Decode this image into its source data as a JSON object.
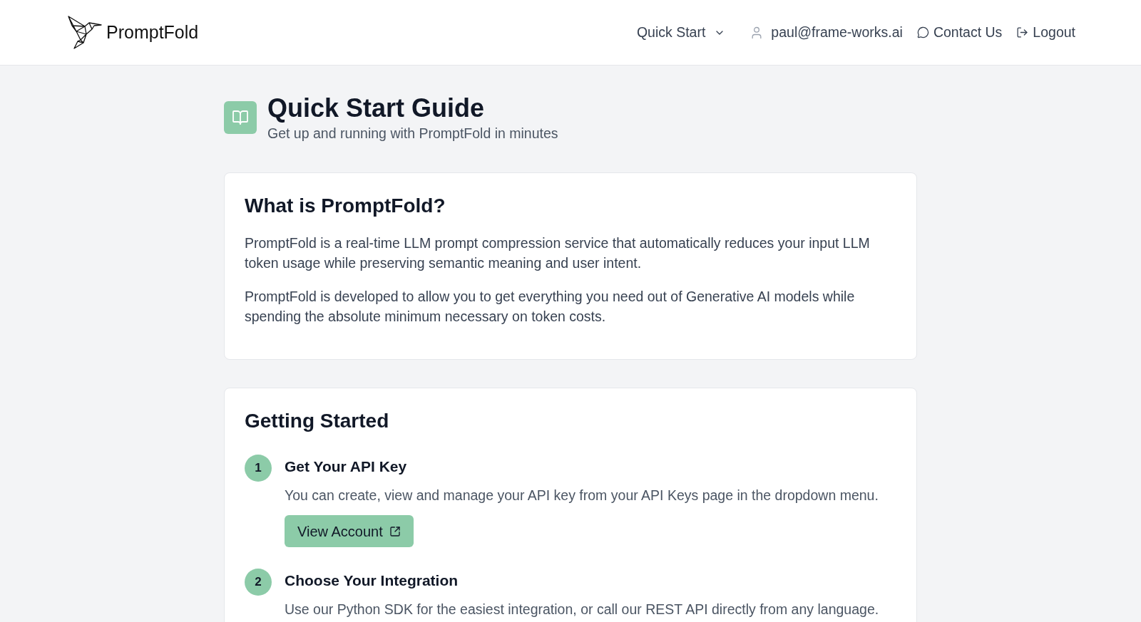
{
  "header": {
    "brand": "PromptFold",
    "nav": [
      {
        "kind": "dropdown",
        "label": "Quick Start"
      },
      {
        "kind": "user",
        "label": "paul@frame-works.ai"
      },
      {
        "kind": "contact",
        "label": "Contact Us"
      },
      {
        "kind": "logout",
        "label": "Logout"
      }
    ]
  },
  "page": {
    "title": "Quick Start Guide",
    "subtitle": "Get up and running with PromptFold in minutes"
  },
  "sections": [
    {
      "heading": "What is PromptFold?",
      "paragraphs": [
        "PromptFold is a real-time LLM prompt compression service that automatically reduces your input LLM token usage while preserving semantic meaning and user intent.",
        "PromptFold is developed to allow you to get everything you need out of Generative AI models while spending the absolute minimum necessary on token costs."
      ]
    },
    {
      "heading": "Getting Started",
      "steps": [
        {
          "number": "1",
          "title": "Get Your API Key",
          "description": "You can create, view and manage your API key from your API Keys page in the dropdown menu.",
          "button": {
            "label": "View Account"
          }
        },
        {
          "number": "2",
          "title": "Choose Your Integration",
          "description": "Use our Python SDK for the easiest integration, or call our REST API directly from any language."
        }
      ]
    }
  ]
}
